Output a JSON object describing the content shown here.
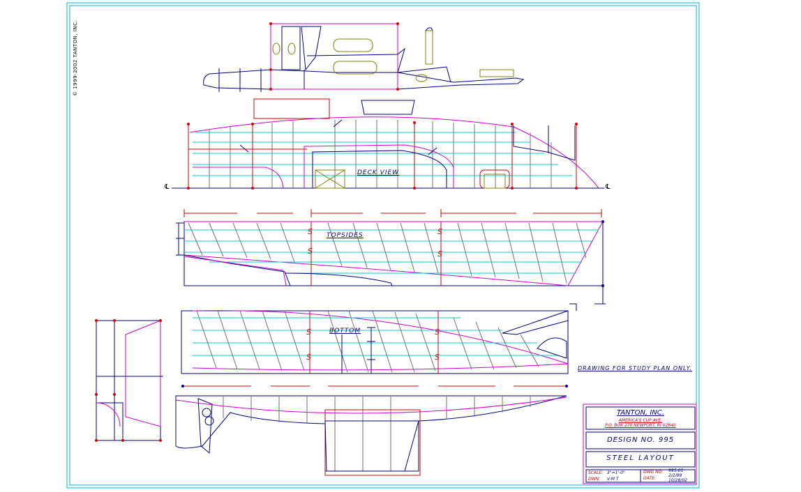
{
  "copyright": "© 1999-2002 TANTON, INC.",
  "views": {
    "deck": "DECK VIEW",
    "topsides": "TOPSIDES",
    "bottom": "BOTTOM"
  },
  "note": "DRAWING FOR STUDY PLAN ONLY.",
  "centerline_symbol": "℄",
  "station_symbol": "S",
  "title_block": {
    "company": "TANTON, INC.",
    "address_line1": "AMERICA'S CUP AVE.",
    "address_line2": "P.O. BOX 270 NEWPORT, RI 02840",
    "design": "DESIGN NO. 995",
    "sheet_title": "STEEL LAYOUT",
    "scale_label": "SCALE:",
    "scale_value": "3\"=1'-0\"",
    "dwn_label": "DWN:",
    "dwn_value": "V-M T",
    "dwg_label": "DWG NO.",
    "dwg_value": "995-05",
    "date_label": "DATE:",
    "date_value1": "2/2/99",
    "date_value2": "10/28/02"
  },
  "colors": {
    "frame": "#00b0d8",
    "hull_outline": "#000080",
    "sheer": "#cc00cc",
    "station": "#e00000",
    "waterline": "#00cccc",
    "frame_line": "#707070",
    "bulkhead": "#808000"
  }
}
